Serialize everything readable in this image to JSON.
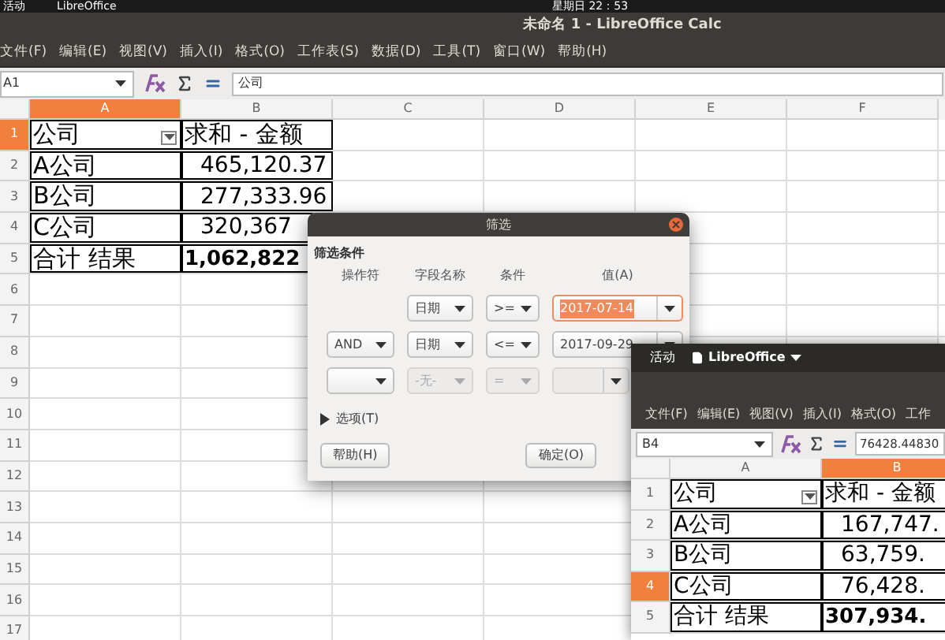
{
  "main_window": {
    "top_bar": {
      "activities": "活动",
      "app": "LibreOffice",
      "clock": "星期日 22：53"
    },
    "title": "未命名 1 - LibreOffice Calc",
    "menu": [
      "文件(F)",
      "编辑(E)",
      "视图(V)",
      "插入(I)",
      "格式(O)",
      "工作表(S)",
      "数据(D)",
      "工具(T)",
      "窗口(W)",
      "帮助(H)"
    ],
    "name_box": "A1",
    "formula": "公司",
    "columns": [
      {
        "label": "A",
        "selected": true
      },
      {
        "label": "B",
        "selected": false
      },
      {
        "label": "C",
        "selected": false
      },
      {
        "label": "D",
        "selected": false
      },
      {
        "label": "E",
        "selected": false
      },
      {
        "label": "F",
        "selected": false
      }
    ],
    "rows": [
      {
        "label": "1",
        "selected": true,
        "cells": [
          {
            "text": "公司",
            "kind": "text",
            "filter_button": true
          },
          {
            "text": "求和 - 金额",
            "kind": "text"
          }
        ]
      },
      {
        "label": "2",
        "selected": false,
        "cells": [
          {
            "text": "A公司",
            "kind": "text"
          },
          {
            "text": "465,120.37",
            "kind": "number"
          }
        ]
      },
      {
        "label": "3",
        "selected": false,
        "cells": [
          {
            "text": "B公司",
            "kind": "text"
          },
          {
            "text": "277,333.96",
            "kind": "number"
          }
        ]
      },
      {
        "label": "4",
        "selected": false,
        "cells": [
          {
            "text": "C公司",
            "kind": "text"
          },
          {
            "text": "320,367",
            "kind": "number"
          }
        ]
      },
      {
        "label": "5",
        "selected": false,
        "cells": [
          {
            "text": "合计 结果",
            "kind": "text"
          },
          {
            "text": "1,062,822",
            "kind": "number",
            "bold": true
          }
        ]
      },
      {
        "label": "6",
        "selected": false
      },
      {
        "label": "7",
        "selected": false
      },
      {
        "label": "8",
        "selected": false
      },
      {
        "label": "9",
        "selected": false
      },
      {
        "label": "10",
        "selected": false
      },
      {
        "label": "11",
        "selected": false
      },
      {
        "label": "12",
        "selected": false
      },
      {
        "label": "13",
        "selected": false
      },
      {
        "label": "14",
        "selected": false
      },
      {
        "label": "15",
        "selected": false
      },
      {
        "label": "16",
        "selected": false
      },
      {
        "label": "17",
        "selected": false
      }
    ]
  },
  "filter_dialog": {
    "title": "筛选",
    "section": "筛选条件",
    "headers": [
      "操作符",
      "字段名称",
      "条件",
      "值(A)"
    ],
    "conditions": [
      {
        "field": {
          "value": "日期",
          "disabled": false
        },
        "condition": {
          "value": ">=",
          "disabled": false
        },
        "value": {
          "value": "2017-07-14",
          "focused": true,
          "text_selected": true,
          "disabled": false
        }
      },
      {
        "operator": {
          "value": "AND",
          "disabled": false
        },
        "field": {
          "value": "日期",
          "disabled": false
        },
        "condition": {
          "value": "<=",
          "disabled": false
        },
        "value": {
          "value": "2017-09-29",
          "focused": false,
          "disabled": false
        }
      },
      {
        "operator": {
          "disabled": false
        },
        "field": {
          "value": "-无-",
          "disabled": true
        },
        "condition": {
          "value": "=",
          "disabled": true
        },
        "value": {
          "focused": false,
          "disabled": true
        }
      }
    ],
    "options": {
      "label": "选项(T)",
      "expanded": false
    },
    "buttons": [
      "帮助(H)",
      "确定(O)"
    ]
  },
  "second_window": {
    "top_bar": {
      "activities": "活动",
      "app": "LibreOffice"
    },
    "menu": [
      "文件(F)",
      "编辑(E)",
      "视图(V)",
      "插入(I)",
      "格式(O)",
      "工作"
    ],
    "name_box": "B4",
    "formula": "76428.44830",
    "columns": [
      {
        "label": "A",
        "selected": false
      },
      {
        "label": "B",
        "selected": true
      }
    ],
    "rows": [
      {
        "label": "1",
        "selected": false,
        "cells": [
          {
            "text": "公司",
            "kind": "text",
            "filter_button": true
          },
          {
            "text": "求和 - 金额",
            "kind": "text"
          }
        ]
      },
      {
        "label": "2",
        "selected": false,
        "cells": [
          {
            "text": "A公司",
            "kind": "text"
          },
          {
            "text": "167,747.",
            "kind": "number"
          }
        ]
      },
      {
        "label": "3",
        "selected": false,
        "cells": [
          {
            "text": "B公司",
            "kind": "text"
          },
          {
            "text": "63,759.",
            "kind": "number"
          }
        ]
      },
      {
        "label": "4",
        "selected": true,
        "cells": [
          {
            "text": "C公司",
            "kind": "text"
          },
          {
            "text": "76,428.",
            "kind": "number"
          }
        ]
      },
      {
        "label": "5",
        "selected": false,
        "cells": [
          {
            "text": "合计 结果",
            "kind": "text"
          },
          {
            "text": "307,934.",
            "kind": "number",
            "bold": true
          }
        ]
      }
    ]
  }
}
